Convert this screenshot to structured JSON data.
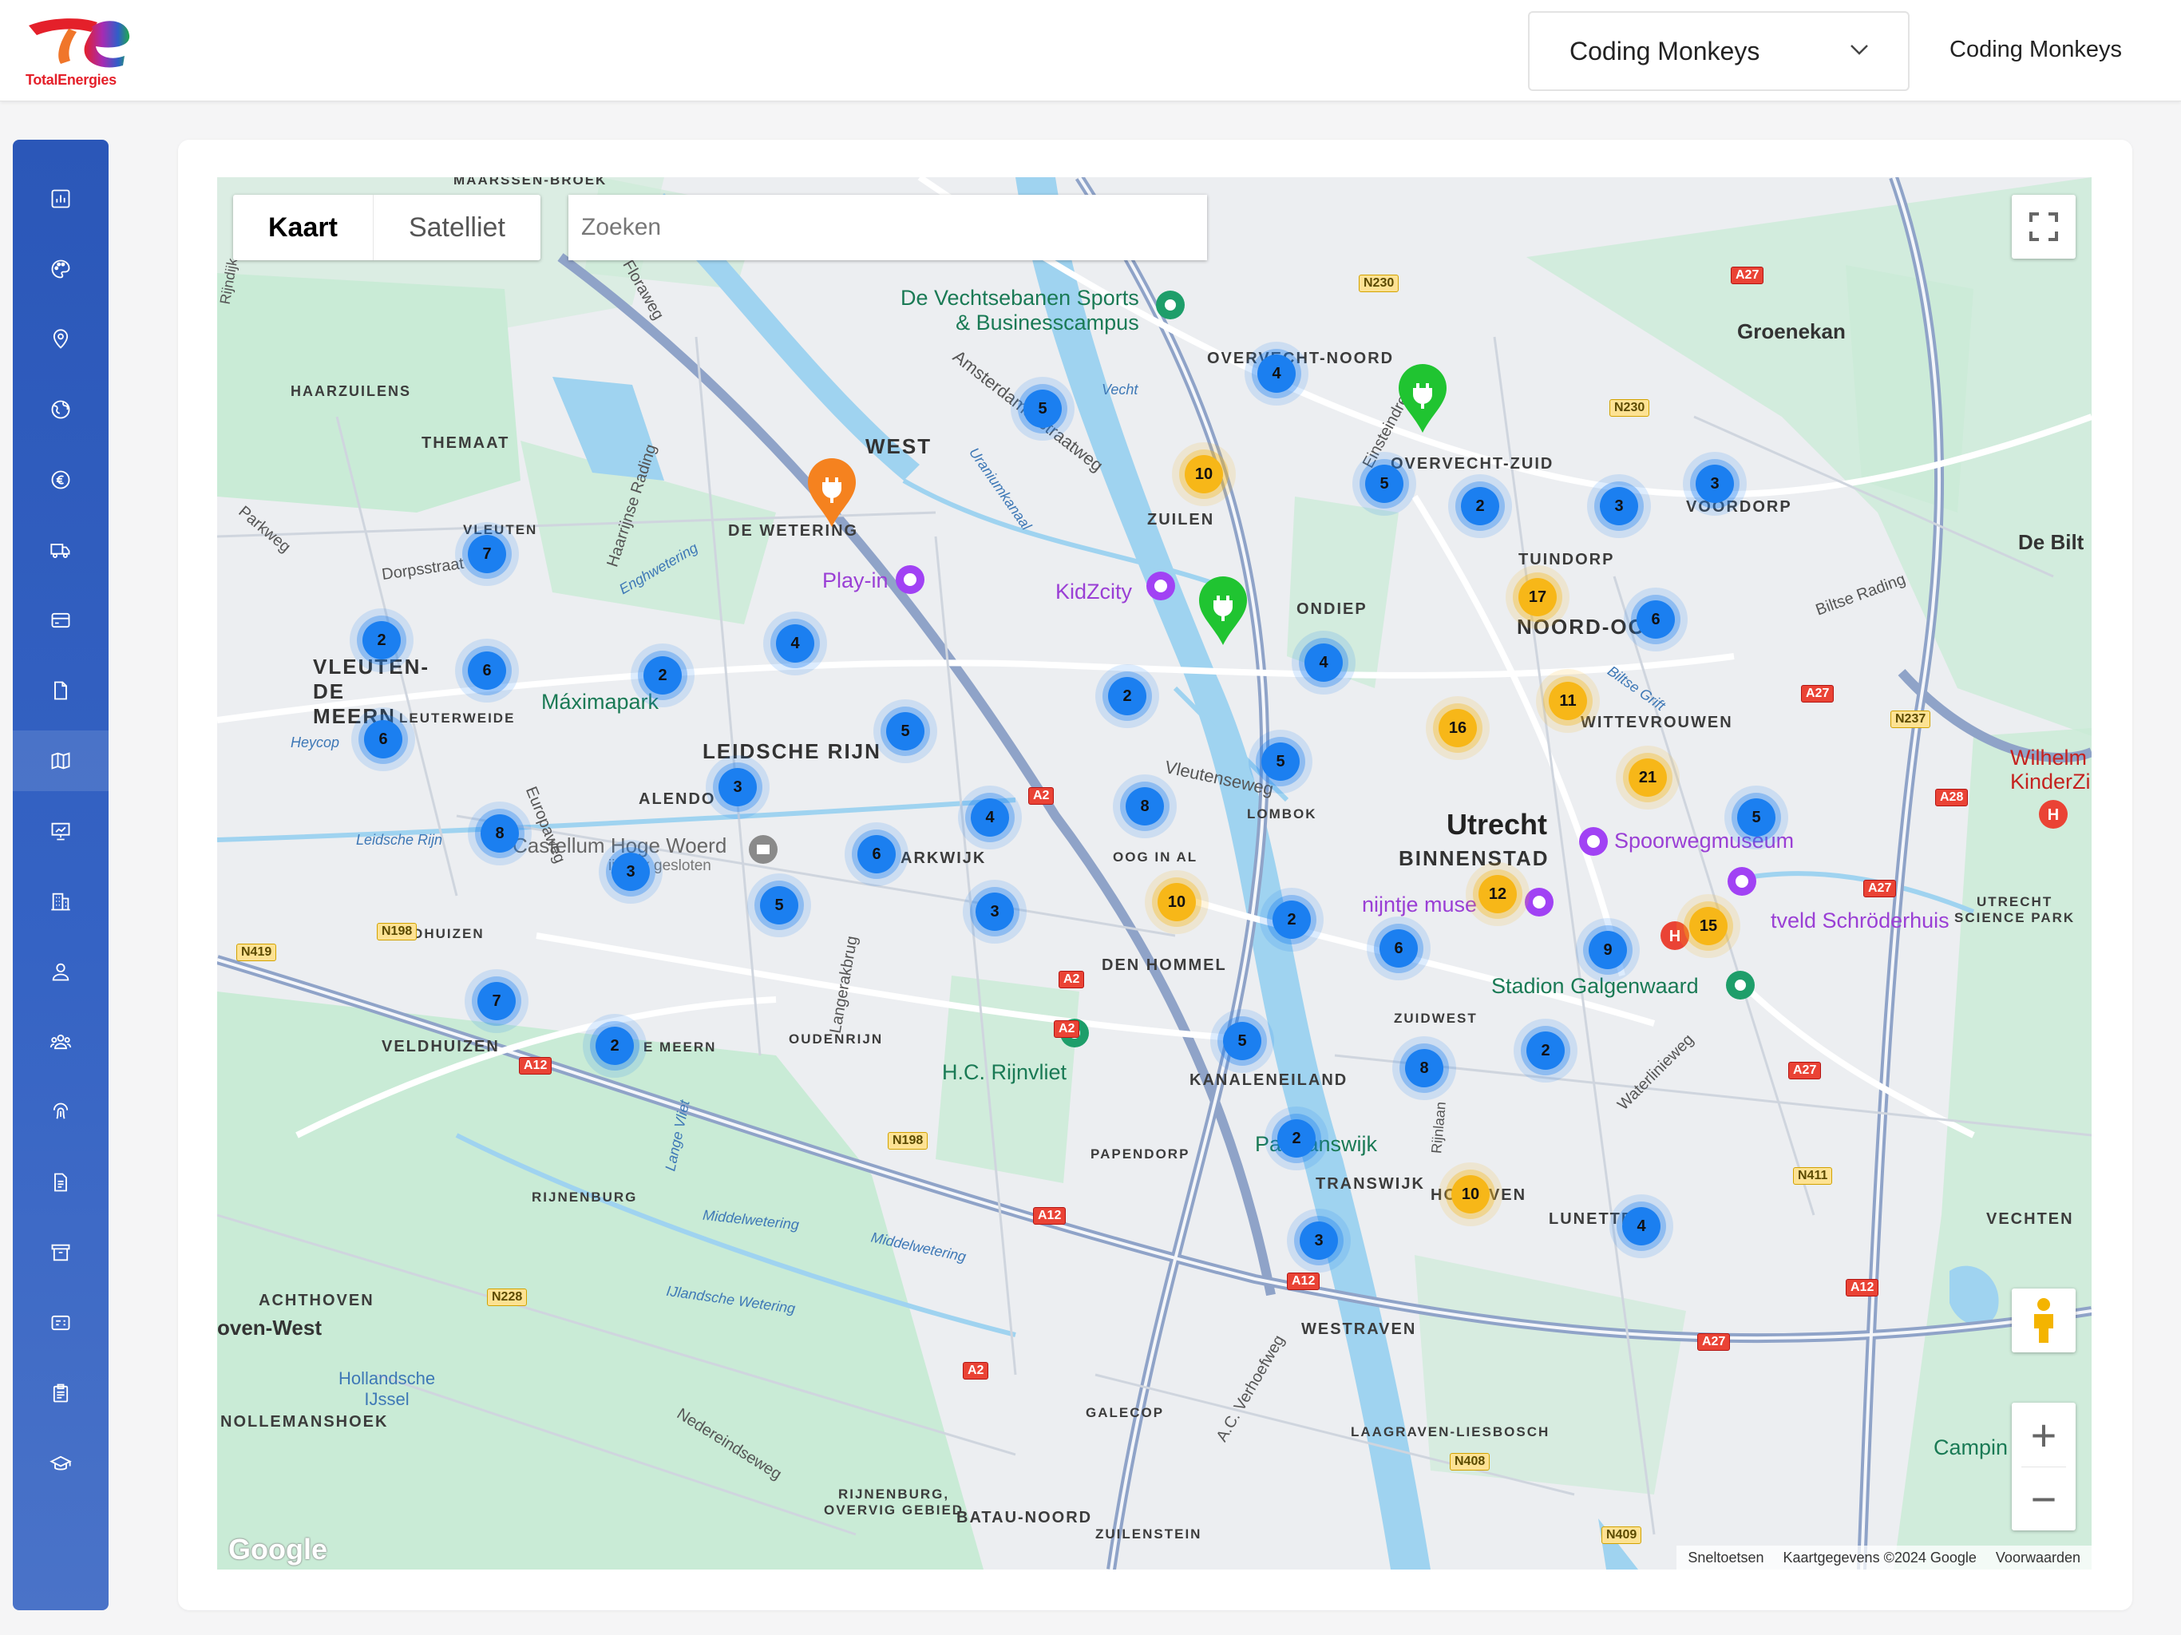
{
  "brand": {
    "logo_text": "TotalEnergies"
  },
  "header": {
    "org_select": "Coding Monkeys",
    "user_name": "Coding Monkeys"
  },
  "sidebar": {
    "items": [
      {
        "icon": "bar-chart-icon"
      },
      {
        "icon": "palette-icon"
      },
      {
        "icon": "location-pin-icon"
      },
      {
        "icon": "globe-icon"
      },
      {
        "icon": "euro-icon"
      },
      {
        "icon": "truck-icon"
      },
      {
        "icon": "credit-card-icon"
      },
      {
        "icon": "document-icon"
      },
      {
        "icon": "map-icon",
        "active": true
      },
      {
        "icon": "presentation-icon"
      },
      {
        "icon": "building-icon"
      },
      {
        "icon": "user-icon"
      },
      {
        "icon": "users-group-icon"
      },
      {
        "icon": "fingerprint-icon"
      },
      {
        "icon": "file-text-icon"
      },
      {
        "icon": "archive-icon"
      },
      {
        "icon": "id-card-icon"
      },
      {
        "icon": "clipboard-icon"
      },
      {
        "icon": "graduation-cap-icon"
      }
    ]
  },
  "map": {
    "type_tabs": [
      "Kaart",
      "Satelliet"
    ],
    "search_placeholder": "Zoeken",
    "footer": {
      "shortcuts": "Sneltoetsen",
      "data": "Kaartgegevens ©2024 Google",
      "terms": "Voorwaarden"
    },
    "google_watermark": "Google",
    "clusters_blue": [
      "4",
      "5",
      "5",
      "2",
      "3",
      "3",
      "7",
      "2",
      "6",
      "6",
      "4",
      "2",
      "6",
      "2",
      "5",
      "4",
      "5",
      "3",
      "8",
      "4",
      "6",
      "8",
      "3",
      "5",
      "5",
      "3",
      "2",
      "6",
      "9",
      "7",
      "2",
      "5",
      "8",
      "2",
      "2",
      "3",
      "4"
    ],
    "clusters_yellow": [
      "10",
      "17",
      "11",
      "16",
      "21",
      "10",
      "12",
      "15",
      "10"
    ],
    "labels": {
      "utrecht": "Utrecht",
      "binnenstad": "BINNENSTAD",
      "west": "WEST",
      "zuilen": "ZUILEN",
      "overvecht_noord": "OVERVECHT-NOORD",
      "overvecht_zuid": "OVERVECHT-ZUID",
      "voordorp": "VOORDORP",
      "tuindorp": "TUINDORP",
      "noord_oost": "NOORD-OO",
      "wittevrouwen": "WITTEVROUWEN",
      "ondiep": "ONDIEP",
      "de_wetering": "DE WETERING",
      "themaat": "THEMAAT",
      "haarzuilens": "HAARZUILENS",
      "vleuten": "VLEUTEN",
      "vleuten_de_meern": "VLEUTEN-DE MEERN",
      "leidsche_rijn": "LEIDSCHE RIJN",
      "alendorp": "ALENDO",
      "parkwijk": "ARKWIJK",
      "lombok": "LOMBOK",
      "oog_in_al": "OOG IN AL",
      "den_hommel": "DEN HOMMEL",
      "kanaleneiland": "KANALENEILAND",
      "transwijk": "TRANSWIJK",
      "westraven": "WESTRAVEN",
      "hoograven": "HO   RAVEN",
      "lunetten": "LUNETTE",
      "zuidwest": "ZUIDWEST",
      "veldhuizen": "VELDHUIZEN",
      "veldhuizen2": "VELDHUIZEN",
      "de_meern": "E MEERN",
      "oudenrijn": "OUDENRIJN",
      "papendorp": "PAPENDORP",
      "rijnenburg": "RIJNENBURG",
      "achthoven": "ACHTHOVEN",
      "nollemanshoek": "NOLLEMANSHOEK",
      "galecop": "GALECOP",
      "batau_noord": "BATAU-NOORD",
      "zuilenstein": "ZUILENSTEIN",
      "laagraven": "LAAGRAVEN-LIESBOSCH",
      "rijnenburg_gebied": "RIJNENBURG,\nOVERVIG GEBIED",
      "groenekan": "Groenekan",
      "de_bilt": "De Bilt",
      "vechten": "VECHTEN",
      "utrecht_science_park": "UTRECHT\nSCIENCE PARK",
      "oven_west": "oven-West",
      "leuterweide": "LEUTERWEIDE",
      "maarssen": "MAARSSEN-BROEK"
    },
    "pois": {
      "vechtsebanen": "De Vechtsebanen Sports\n& Businesscampus",
      "playin": "Play-in",
      "kidzcity": "KidZcity",
      "maximapark": "Máximapark",
      "castellum": "Castellum Hoge Woerd",
      "castellum_sub": "ijdelijk gesloten",
      "spoorwegmuseum": "Spoorwegmuseum",
      "nijntje": "nijntje muse",
      "schroder": "tveld Schröderhuis",
      "galgenwaard": "Stadion Galgenwaard",
      "rijnvliet": "H.C. Rijnvliet",
      "park_transwijk": "Pa   Transwijk",
      "wilhelmina": "Wilhelm\nKinderZi",
      "hollandsche": "Hollandsche\nIJssel",
      "camping": "Campin"
    },
    "water": {
      "vecht": "Vecht",
      "leidsche_rijn_w": "Leidsche Rijn",
      "engh": "Enghwetering",
      "middel1": "Middelwetering",
      "middel2": "Middelwetering",
      "ijland": "IJlandsche Wetering",
      "heycop": "Heycop",
      "lange_vliet": "Lange Vliet",
      "uranium": "Uraniumkanaal",
      "bilts_grift": "Biltse Grift"
    },
    "roads": {
      "a2": "A2",
      "a12": "A12",
      "a27": "A27",
      "a28": "A28",
      "n230": "N230",
      "n198": "N198",
      "n419": "N419",
      "n228": "N228",
      "n408": "N408",
      "n409": "N409",
      "n411": "N411",
      "n237": "N237",
      "amsterdamsestraatweg": "Amsterdamsestraatweg",
      "vleutenseweg": "Vleutenseweg",
      "europaweg": "Europaweg",
      "langerakbrug": "Langerakbrug",
      "haarrijnse": "Haarrijnse Rading",
      "floraweg": "Floraweg",
      "parkweg": "Parkweg",
      "dorpsstraat": "Dorpsstraat",
      "einsteindreef": "Einsteindreef",
      "biltse_rading": "Biltse Rading",
      "waterlinieweg": "Waterlinieweg",
      "rijnlaan": "Rijnlaan",
      "verhoefweg": "A.C. Verhoefweg",
      "nedereindseweg": "Nedereindseweg",
      "rijndijk": "Rijndijk"
    }
  }
}
